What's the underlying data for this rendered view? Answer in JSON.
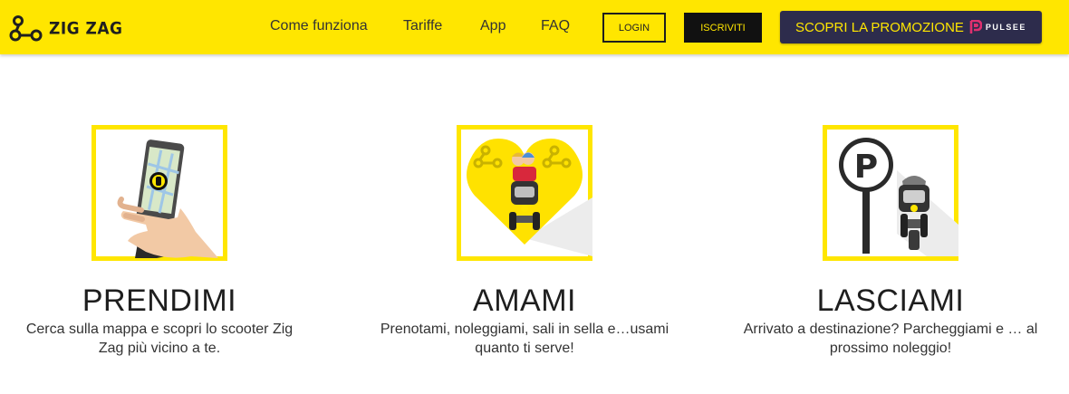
{
  "header": {
    "brand": "ZIG ZAG",
    "nav": [
      {
        "label": "Come funziona"
      },
      {
        "label": "Tariffe"
      },
      {
        "label": "App"
      },
      {
        "label": "FAQ"
      }
    ],
    "login_label": "LOGIN",
    "signup_label": "ISCRIVITI",
    "promo_label": "SCOPRI LA PROMOZIONE",
    "promo_brand": "PULSEE"
  },
  "features": [
    {
      "title": "PRENDIMI",
      "description": "Cerca sulla mappa e scopri lo scooter Zig Zag più vicino a te."
    },
    {
      "title": "AMAMI",
      "description": "Prenotami, noleggiami, sali in sella e…usami quanto ti serve!"
    },
    {
      "title": "LASCIAMI",
      "description": "Arrivato a destinazione? Parcheggiami e … al prossimo noleggio!"
    }
  ],
  "illustrations": {
    "parking_sign_letter": "P"
  },
  "colors": {
    "brand_yellow": "#ffe600",
    "dark": "#1e1e1e",
    "promo_bg": "#2d2c4c",
    "pulsee_accent": "#e0306f"
  }
}
